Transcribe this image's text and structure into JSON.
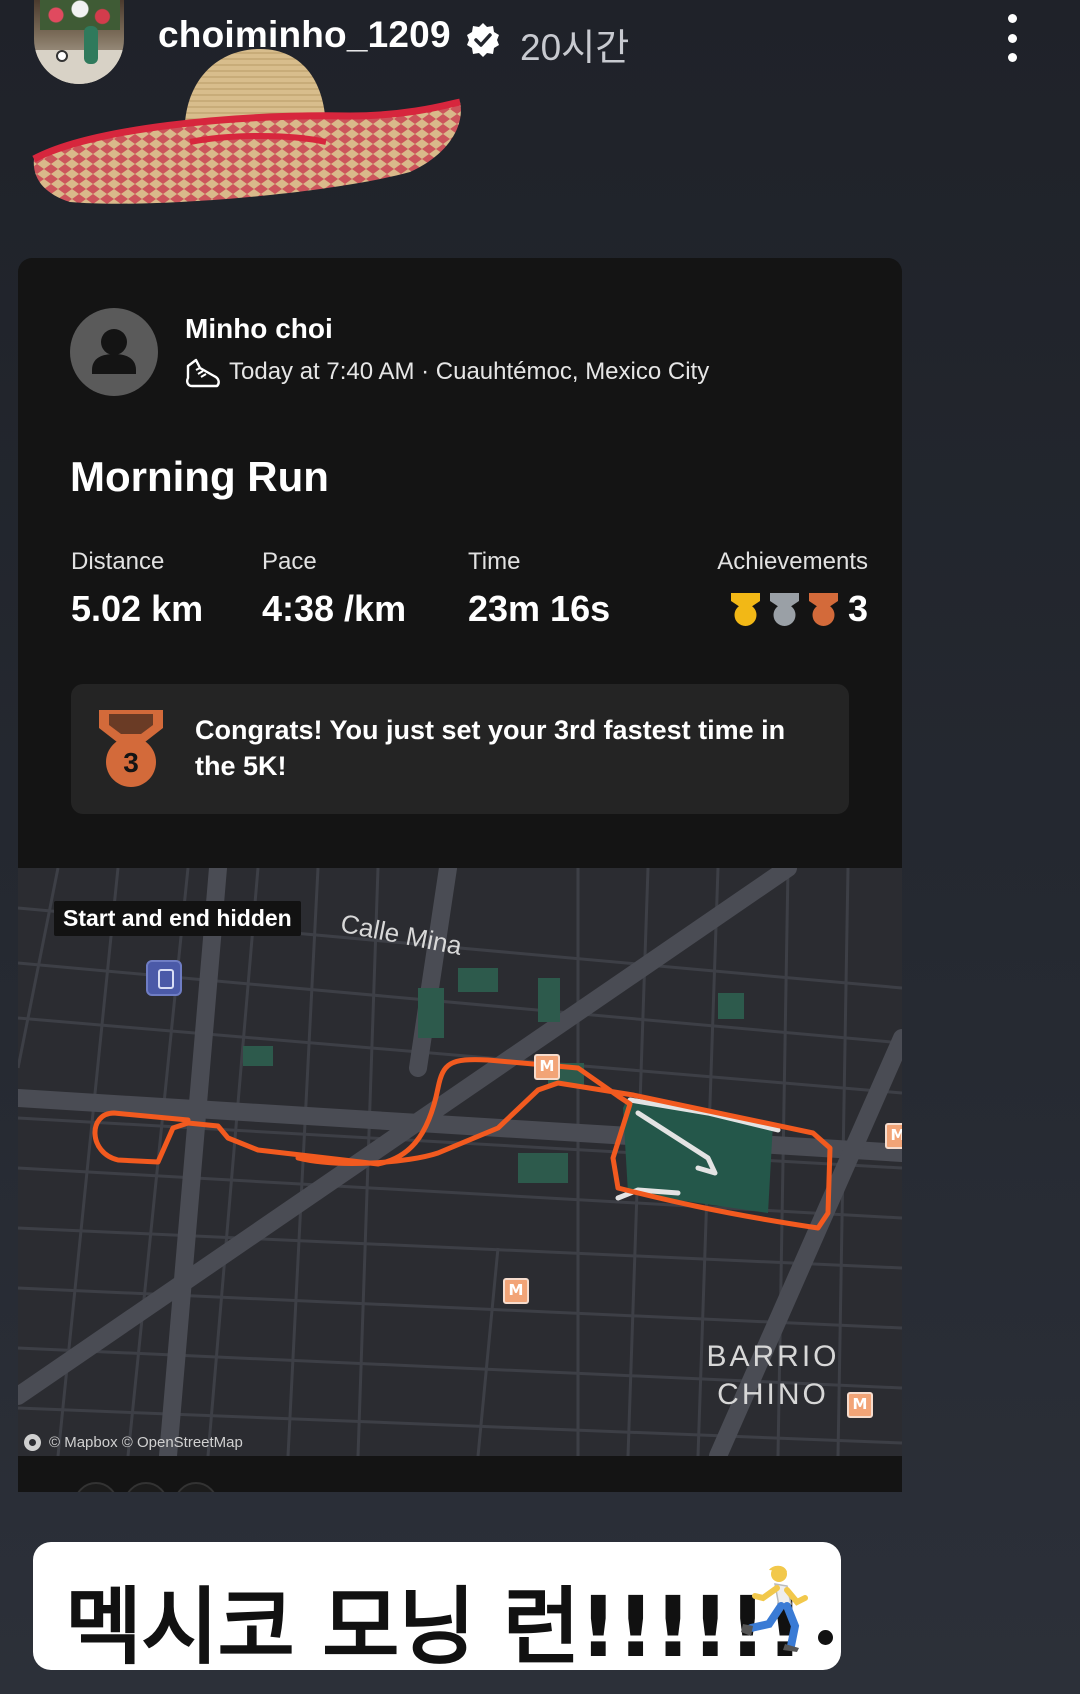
{
  "story": {
    "username": "choiminho_1209",
    "time_ago": "20시간",
    "verified_icon": "verified-badge-icon",
    "more_icon": "more-vertical-icon"
  },
  "activity": {
    "athlete_name": "Minho choi",
    "meta": "Today at 7:40 AM · Cuauhtémoc, Mexico City",
    "title": "Morning Run",
    "stats": {
      "distance_label": "Distance",
      "distance_value": "5.02 km",
      "pace_label": "Pace",
      "pace_value": "4:38 /km",
      "time_label": "Time",
      "time_value": "23m 16s",
      "achievements_label": "Achievements",
      "achievements_count": "3"
    },
    "achievement_colors": [
      "#f2b816",
      "#9aa0a6",
      "#d36a3a"
    ],
    "congrats_medal_number": "3",
    "congrats_text": "Congrats! You just set your 3rd fastest time in the 5K!"
  },
  "map": {
    "privacy_badge": "Start and end hidden",
    "street_label": "Calle Mina",
    "district_line1": "BARRIO",
    "district_line2": "CHINO",
    "attribution": "© Mapbox © OpenStreetMap",
    "route_color": "#f25a1f",
    "park_color": "#24574a"
  },
  "caption": {
    "text": "멕시코 모닝 런!!!!!!",
    "emoji": "person-running-icon"
  }
}
